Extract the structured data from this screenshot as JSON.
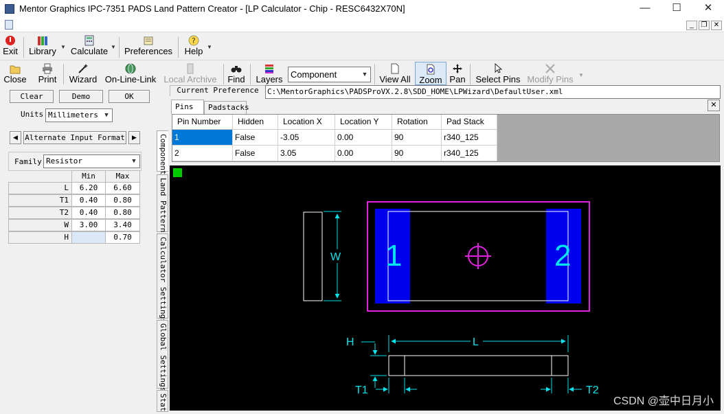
{
  "window": {
    "title": "Mentor Graphics IPC-7351 PADS Land Pattern Creator  - [LP Calculator - Chip - RESC6432X70N]",
    "minimize": "—",
    "maximize": "☐",
    "close": "✕"
  },
  "mdi": {
    "minimize": "_",
    "restore": "❐",
    "close": "✕"
  },
  "menu": {
    "exit": "Exit",
    "library": "Library",
    "calculate": "Calculate",
    "preferences": "Preferences",
    "help": "Help"
  },
  "toolbar": {
    "close": "Close",
    "print": "Print",
    "wizard": "Wizard",
    "online_link": "On-Line-Link",
    "local_archive": "Local Archive",
    "find": "Find",
    "layers": "Layers",
    "component_select": "Component",
    "view_all": "View All",
    "zoom": "Zoom",
    "pan": "Pan",
    "select_pins": "Select Pins",
    "modify_pins": "Modify Pins"
  },
  "preference": {
    "label": "Current Preference",
    "path": "C:\\MentorGraphics\\PADSProVX.2.8\\SDD_HOME\\LPWizard\\DefaultUser.xml"
  },
  "left_panel": {
    "clear": "Clear",
    "demo": "Demo",
    "ok": "OK",
    "units_label": "Units",
    "units_value": "Millimeters",
    "alt_input": "Alternate Input Format",
    "prev": "◀",
    "next": "▶",
    "family_label": "Family",
    "family_value": "Resistor",
    "dims_header": {
      "min": "Min",
      "max": "Max"
    },
    "dims": [
      {
        "name": "L",
        "min": "6.20",
        "max": "6.60"
      },
      {
        "name": "T1",
        "min": "0.40",
        "max": "0.80"
      },
      {
        "name": "T2",
        "min": "0.40",
        "max": "0.80"
      },
      {
        "name": "W",
        "min": "3.00",
        "max": "3.40"
      },
      {
        "name": "H",
        "min": "",
        "max": "0.70"
      }
    ]
  },
  "vertical_tabs": [
    "Component",
    "Land Pattern",
    "Calculator Settings",
    "Global Settings",
    "Stat"
  ],
  "pins_panel": {
    "tabs": [
      "Pins",
      "Padstacks"
    ],
    "close": "✕",
    "columns": [
      "Pin Number",
      "Hidden",
      "Location X",
      "Location Y",
      "Rotation",
      "Pad Stack"
    ],
    "rows": [
      [
        "1",
        "False",
        "-3.05",
        "0.00",
        "90",
        "r340_125"
      ],
      [
        "2",
        "False",
        "3.05",
        "0.00",
        "90",
        "r340_125"
      ]
    ]
  },
  "drawing": {
    "pad1": "1",
    "pad2": "2",
    "dim_w": "W",
    "dim_l": "L",
    "dim_h": "H",
    "dim_t1": "T1",
    "dim_t2": "T2",
    "colors": {
      "background": "#000000",
      "pad": "#0000ee",
      "courtyard": "#e020e0",
      "outline": "#ffffff",
      "dimension": "#00e5ee",
      "marker": "#00cc00"
    }
  },
  "watermark": "CSDN @壶中日月小"
}
